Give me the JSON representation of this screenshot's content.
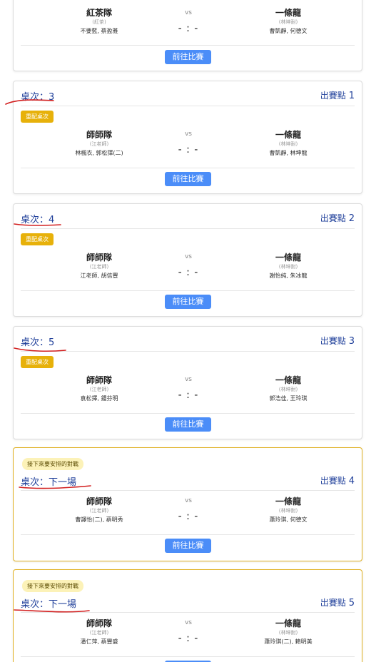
{
  "vs_label": "vs",
  "score_placeholder": "- : -",
  "go_button_label": "前往比賽",
  "assigned_badge": "重配桌次",
  "upcoming_tag": "接下來要安排的對戰",
  "venue_prefix": "出賽點",
  "colors": {
    "accent_blue": "#1f3f9a",
    "button_blue": "#4b8df8",
    "badge_yellow": "#e7b10a",
    "upcoming_border": "#e0b020",
    "annotation_red": "#d21f1f"
  },
  "matches": [
    {
      "table": "",
      "venue": "",
      "left_team": {
        "name": "紅茶隊",
        "coach": "(紅茶)",
        "players": "不要藍, 蔡盈雅"
      },
      "right_team": {
        "name": "一條龍",
        "coach": "(林坤耐)",
        "players": "曹凱靜, 何德文"
      }
    },
    {
      "table": "桌次：3",
      "venue": "1",
      "left_team": {
        "name": "師師隊",
        "coach": "(江老師)",
        "players": "林楓衣, 郭松擇(二)"
      },
      "right_team": {
        "name": "一條龍",
        "coach": "(林坤耐)",
        "players": "曹凱靜, 林坤龍"
      }
    },
    {
      "table": "桌次：4",
      "venue": "2",
      "left_team": {
        "name": "師師隊",
        "coach": "(江老師)",
        "players": "江老師, 胡信豐"
      },
      "right_team": {
        "name": "一條龍",
        "coach": "(林坤耐)",
        "players": "謝怡純, 朱冰龍"
      }
    },
    {
      "table": "桌次：5",
      "venue": "3",
      "left_team": {
        "name": "師師隊",
        "coach": "(江老師)",
        "players": "袁松擇, 鍾芬明"
      },
      "right_team": {
        "name": "一條龍",
        "coach": "(林坤耐)",
        "players": "郭浩佳, 王玲琪"
      }
    },
    {
      "table": "桌次：下一場",
      "venue": "4",
      "left_team": {
        "name": "師師隊",
        "coach": "(江老師)",
        "players": "曹譯怡(二), 蔡明秀"
      },
      "right_team": {
        "name": "一條龍",
        "coach": "(林坤耐)",
        "players": "蕭玲琪, 何德文"
      }
    },
    {
      "table": "桌次：下一場",
      "venue": "5",
      "left_team": {
        "name": "師師隊",
        "coach": "(江老師)",
        "players": "潘仁萍, 蔡豐盛"
      },
      "right_team": {
        "name": "一條龍",
        "coach": "(林坤耐)",
        "players": "蕭玲琪(二), 賴明美"
      }
    }
  ]
}
